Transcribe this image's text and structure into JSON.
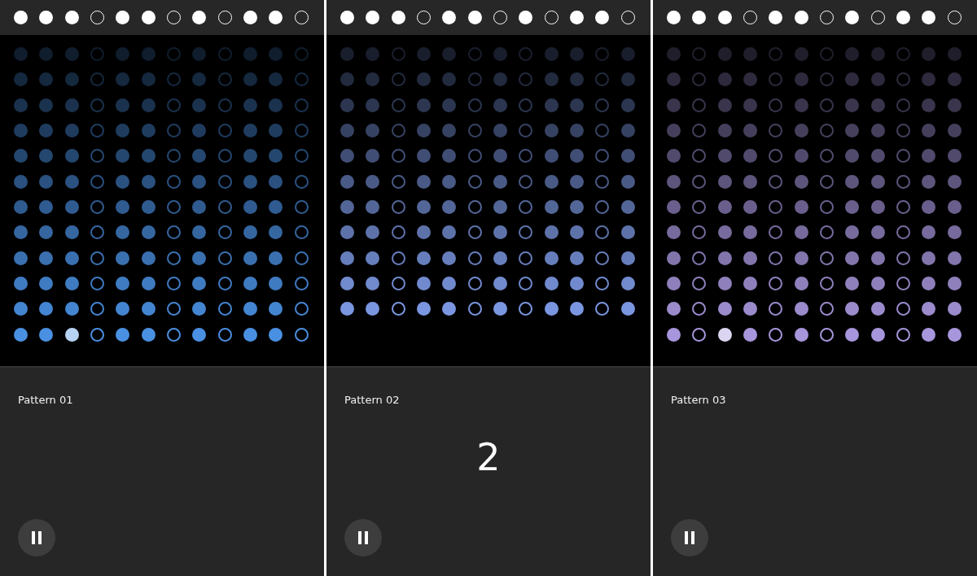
{
  "panels": [
    {
      "color": "#4a90e2",
      "steps": [
        {
          "on": true
        },
        {
          "on": true
        },
        {
          "on": true
        },
        {
          "on": false
        },
        {
          "on": true
        },
        {
          "on": true
        },
        {
          "on": false
        },
        {
          "on": true
        },
        {
          "on": false
        },
        {
          "on": true
        },
        {
          "on": true
        },
        {
          "on": false
        }
      ],
      "grid": {
        "columns": [
          {
            "filled": true,
            "current": false
          },
          {
            "filled": true,
            "current": false
          },
          {
            "filled": true,
            "current": true
          },
          {
            "filled": false,
            "current": false
          },
          {
            "filled": true,
            "current": false
          },
          {
            "filled": true,
            "current": false
          },
          {
            "filled": false,
            "current": false
          },
          {
            "filled": true,
            "current": false
          },
          {
            "filled": false,
            "current": false
          },
          {
            "filled": true,
            "current": false
          },
          {
            "filled": true,
            "current": false
          },
          {
            "filled": false,
            "current": false
          }
        ],
        "rows": [
          {
            "current": false
          },
          {
            "current": false
          },
          {
            "current": false
          },
          {
            "current": false
          },
          {
            "current": false
          },
          {
            "current": false
          },
          {
            "current": false
          },
          {
            "current": false
          },
          {
            "current": false
          },
          {
            "current": false
          },
          {
            "current": false
          },
          {
            "current": true
          }
        ]
      },
      "title": "Pattern 01",
      "playing": true
    },
    {
      "color": "#7b96e0",
      "steps": [
        {
          "on": true
        },
        {
          "on": true
        },
        {
          "on": true
        },
        {
          "on": false
        },
        {
          "on": true
        },
        {
          "on": true
        },
        {
          "on": false
        },
        {
          "on": true
        },
        {
          "on": false
        },
        {
          "on": true
        },
        {
          "on": true
        },
        {
          "on": false
        }
      ],
      "grid": {
        "columns": [
          {
            "filled": true
          },
          {
            "filled": true
          },
          {
            "filled": false
          },
          {
            "filled": true
          },
          {
            "filled": true
          },
          {
            "filled": false
          },
          {
            "filled": true
          },
          {
            "filled": false
          },
          {
            "filled": true
          },
          {
            "filled": true
          },
          {
            "filled": false
          },
          {
            "filled": true
          }
        ],
        "rows": [
          {},
          {},
          {},
          {},
          {},
          {},
          {},
          {},
          {},
          {},
          {}
        ]
      },
      "title": "Pattern 02",
      "countdown": "2",
      "playing": true
    },
    {
      "color": "#a796dc",
      "steps": [
        {
          "on": true
        },
        {
          "on": true
        },
        {
          "on": true
        },
        {
          "on": false
        },
        {
          "on": true
        },
        {
          "on": true
        },
        {
          "on": false
        },
        {
          "on": true
        },
        {
          "on": false
        },
        {
          "on": true
        },
        {
          "on": true
        },
        {
          "on": false
        }
      ],
      "grid": {
        "columns": [
          {
            "filled": true,
            "current": false
          },
          {
            "filled": false,
            "current": false
          },
          {
            "filled": true,
            "current": true
          },
          {
            "filled": true,
            "current": false
          },
          {
            "filled": false,
            "current": false
          },
          {
            "filled": true,
            "current": false
          },
          {
            "filled": false,
            "current": false
          },
          {
            "filled": true,
            "current": false
          },
          {
            "filled": true,
            "current": false
          },
          {
            "filled": false,
            "current": false
          },
          {
            "filled": true,
            "current": false
          },
          {
            "filled": true,
            "current": false
          }
        ],
        "rows": [
          {
            "current": false
          },
          {
            "current": false
          },
          {
            "current": false
          },
          {
            "current": false
          },
          {
            "current": false
          },
          {
            "current": false
          },
          {
            "current": false
          },
          {
            "current": false
          },
          {
            "current": false
          },
          {
            "current": false
          },
          {
            "current": false
          },
          {
            "current": true
          }
        ]
      },
      "title": "Pattern 03",
      "playing": true
    }
  ]
}
